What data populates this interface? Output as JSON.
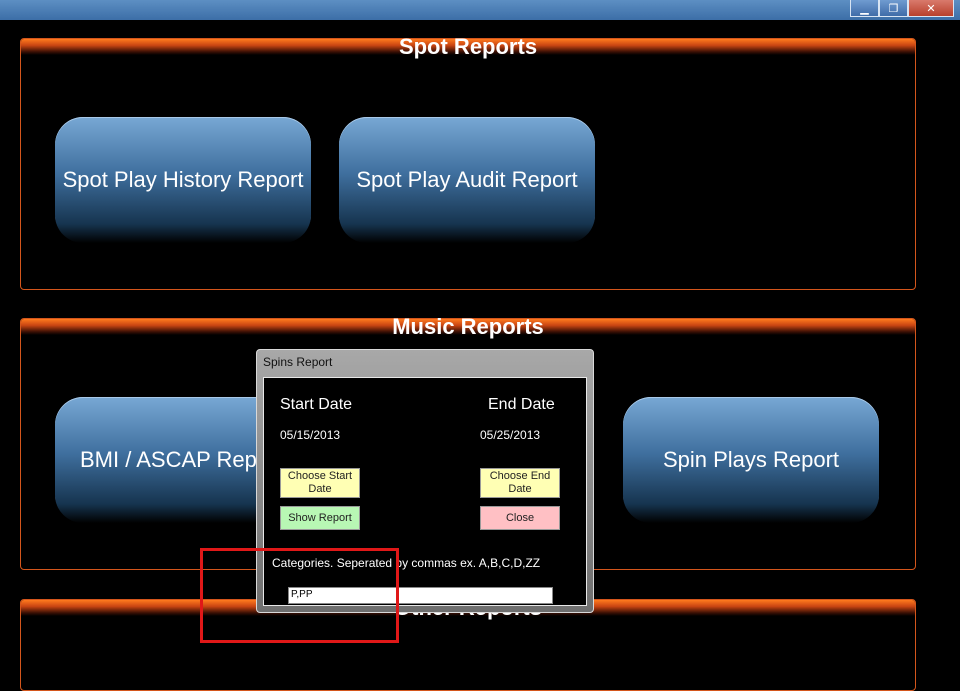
{
  "window": {
    "minimize_glyph": "▁",
    "restore_glyph": "❐",
    "close_glyph": "✕"
  },
  "spot_reports": {
    "title": "Spot Reports",
    "buttons": [
      "Spot Play History Report",
      "Spot Play Audit Report"
    ]
  },
  "music_reports": {
    "title": "Music Reports",
    "buttons": [
      "BMI / ASCAP Report",
      "Spin Plays Report"
    ]
  },
  "other_reports": {
    "title": "Other Reports"
  },
  "dialog": {
    "title": "Spins Report",
    "start_label": "Start Date",
    "end_label": "End Date",
    "start_date": "05/15/2013",
    "end_date": "05/25/2013",
    "choose_start": "Choose Start Date",
    "choose_end": "Choose End Date",
    "show_report": "Show Report",
    "close": "Close",
    "categories_label": "Categories. Seperated by commas ex. A,B,C,D,ZZ",
    "categories_value": "P,PP"
  },
  "colors": {
    "panel_border": "#d4561c",
    "button_blue": "#3f6f9e",
    "highlight": "#e01818"
  }
}
